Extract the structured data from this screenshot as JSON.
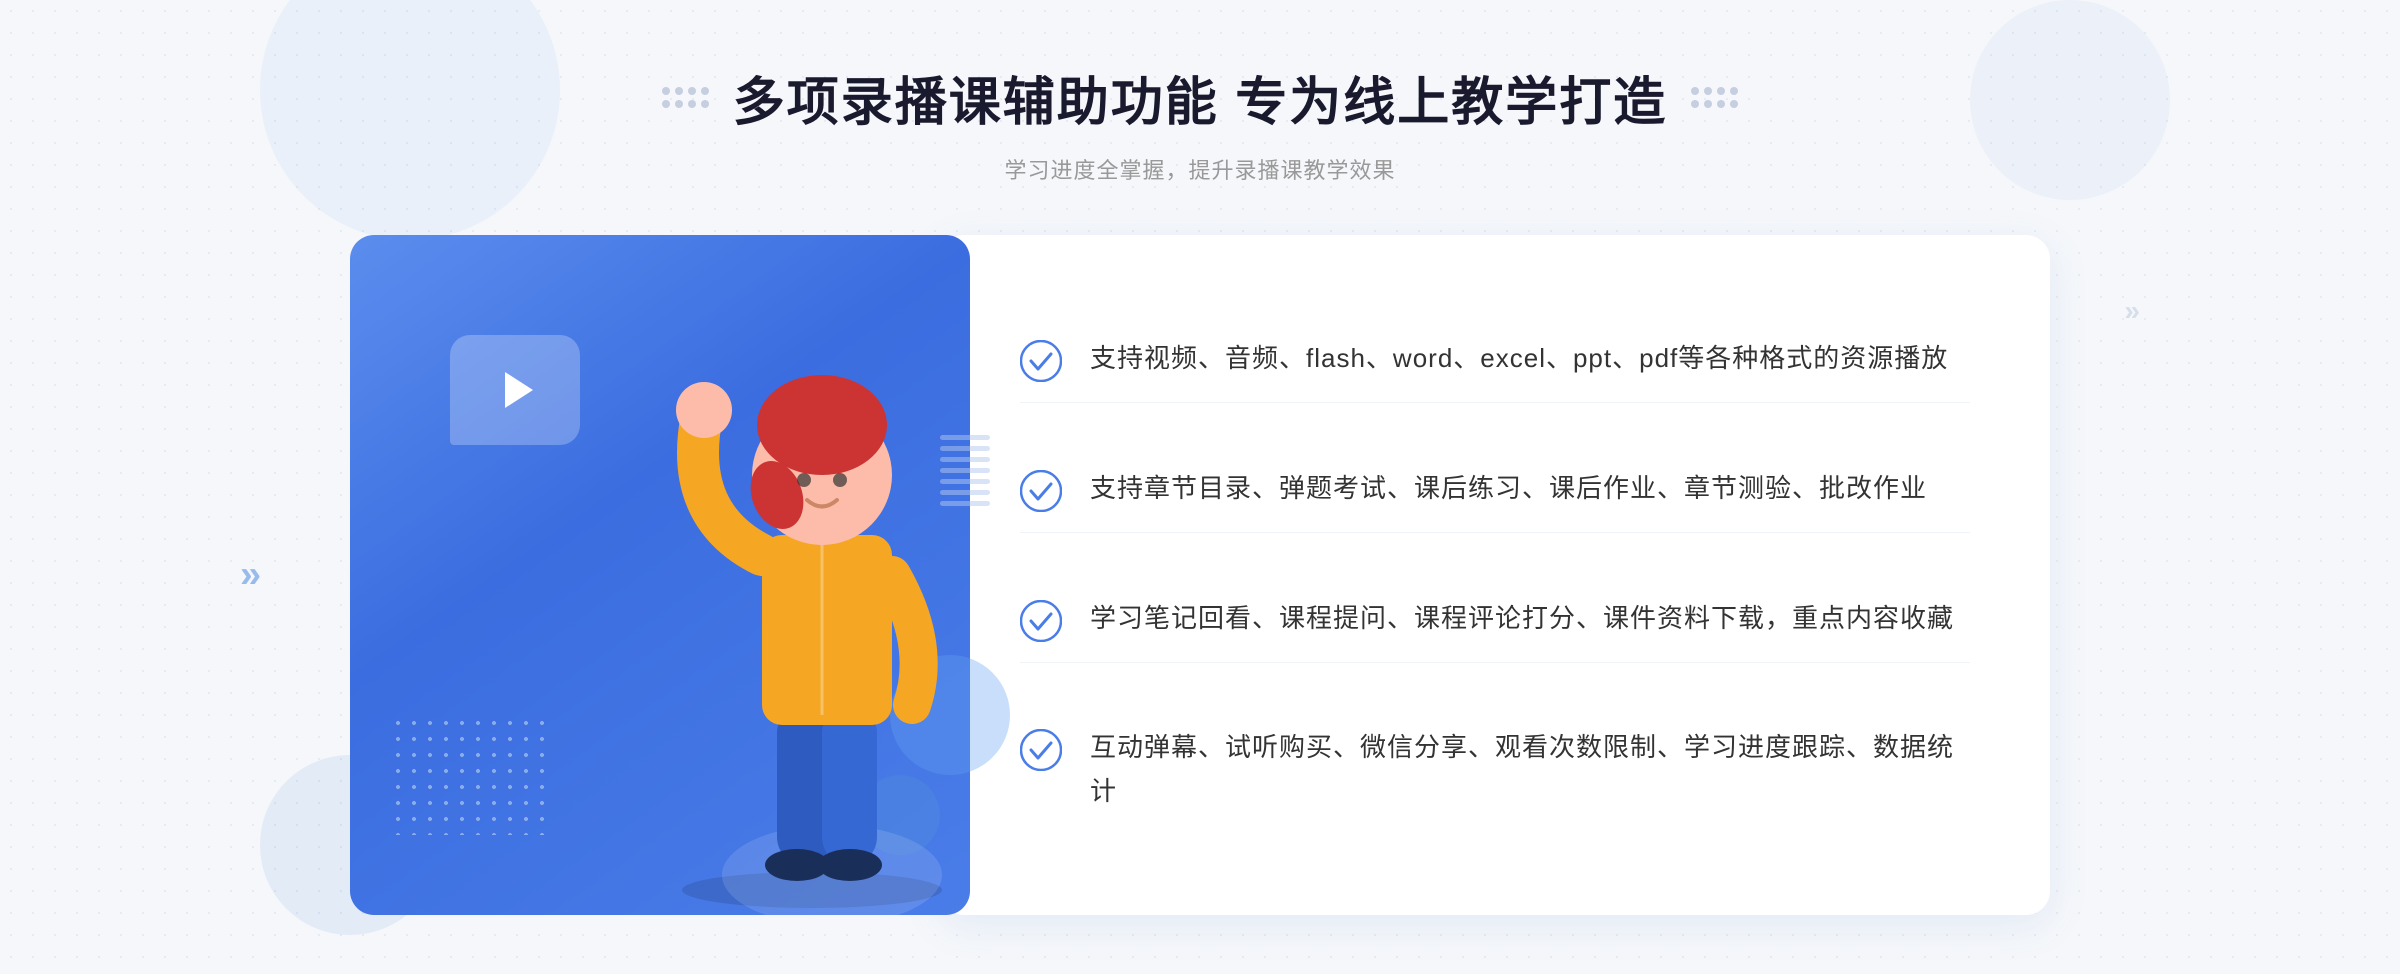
{
  "page": {
    "background_color": "#f5f7fa"
  },
  "header": {
    "main_title": "多项录播课辅助功能 专为线上教学打造",
    "sub_title": "学习进度全掌握，提升录播课教学效果"
  },
  "features": [
    {
      "id": "feature-1",
      "text": "支持视频、音频、flash、word、excel、ppt、pdf等各种格式的资源播放"
    },
    {
      "id": "feature-2",
      "text": "支持章节目录、弹题考试、课后练习、课后作业、章节测验、批改作业"
    },
    {
      "id": "feature-3",
      "text": "学习笔记回看、课程提问、课程评论打分、课件资料下载，重点内容收藏"
    },
    {
      "id": "feature-4",
      "text": "互动弹幕、试听购买、微信分享、观看次数限制、学习进度跟踪、数据统计"
    }
  ],
  "icons": {
    "check_circle": "check-circle",
    "play": "play-icon",
    "chevron_left": "«",
    "chevron_right": "»"
  },
  "colors": {
    "primary_blue": "#4a7de8",
    "light_blue": "#7ba8ee",
    "text_dark": "#1a1a2e",
    "text_gray": "#999999",
    "text_body": "#333333",
    "white": "#ffffff",
    "card_bg": "#ffffff",
    "check_color": "#4a7de8"
  }
}
